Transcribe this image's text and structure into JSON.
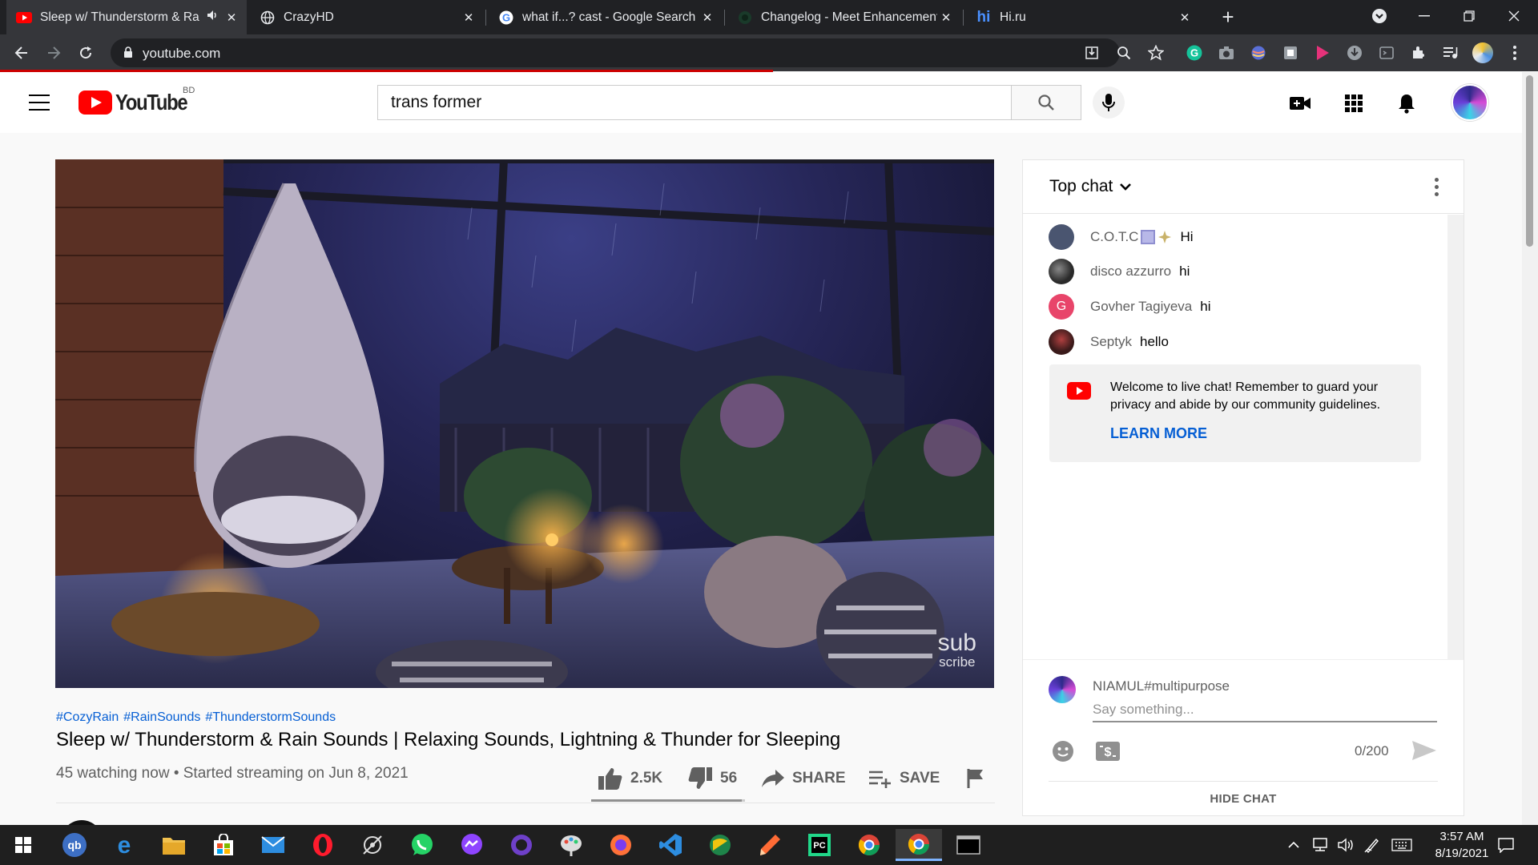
{
  "browser": {
    "tabs": [
      {
        "title": "Sleep w/ Thunderstorm & Ra",
        "favicon": "youtube-icon",
        "audio": true,
        "active": true
      },
      {
        "title": "CrazyHD",
        "favicon": "globe-icon",
        "active": false
      },
      {
        "title": "what if...? cast - Google Search",
        "favicon": "google-icon",
        "active": false
      },
      {
        "title": "Changelog - Meet Enhancement",
        "favicon": "meet-icon",
        "active": false
      },
      {
        "title": "Hi.ru",
        "favicon": "hi-icon",
        "active": false
      }
    ],
    "new_tab": "+",
    "url": "youtube.com"
  },
  "youtube": {
    "logo_text": "YouTube",
    "region": "BD",
    "search_value": "trans former"
  },
  "video": {
    "watermark_line1": "sub",
    "watermark_line2": "scribe",
    "hashtags": [
      "#CozyRain",
      "#RainSounds",
      "#ThunderstormSounds"
    ],
    "title": "Sleep w/ Thunderstorm & Rain Sounds | Relaxing Sounds, Lightning & Thunder for Sleeping",
    "meta": "45 watching now • Started streaming on Jun 8, 2021",
    "likes": "2.5K",
    "dislikes": "56",
    "share_label": "SHARE",
    "save_label": "SAVE",
    "like_ratio": 0.978
  },
  "chat": {
    "header": "Top chat",
    "messages": [
      {
        "author": "C.O.T.C",
        "text": "Hi",
        "avatar_color": "#4a5570"
      },
      {
        "author": "disco azzurro",
        "text": "hi",
        "avatar_color": "#2a2a2a"
      },
      {
        "author": "Govher Tagiyeva",
        "text": "hi",
        "avatar_color": "#e8456a",
        "initial": "G"
      },
      {
        "author": "Septyk",
        "text": "hello",
        "avatar_color": "#3a1a1a"
      }
    ],
    "welcome_text": "Welcome to live chat! Remember to guard your privacy and abide by our community guidelines.",
    "learn_more": "LEARN MORE",
    "user_name": "NIAMUL#multipurpose",
    "input_placeholder": "Say something...",
    "char_count": "0/200",
    "hide_chat": "HIDE CHAT"
  },
  "taskbar": {
    "time": "3:57 AM",
    "date": "8/19/2021"
  }
}
